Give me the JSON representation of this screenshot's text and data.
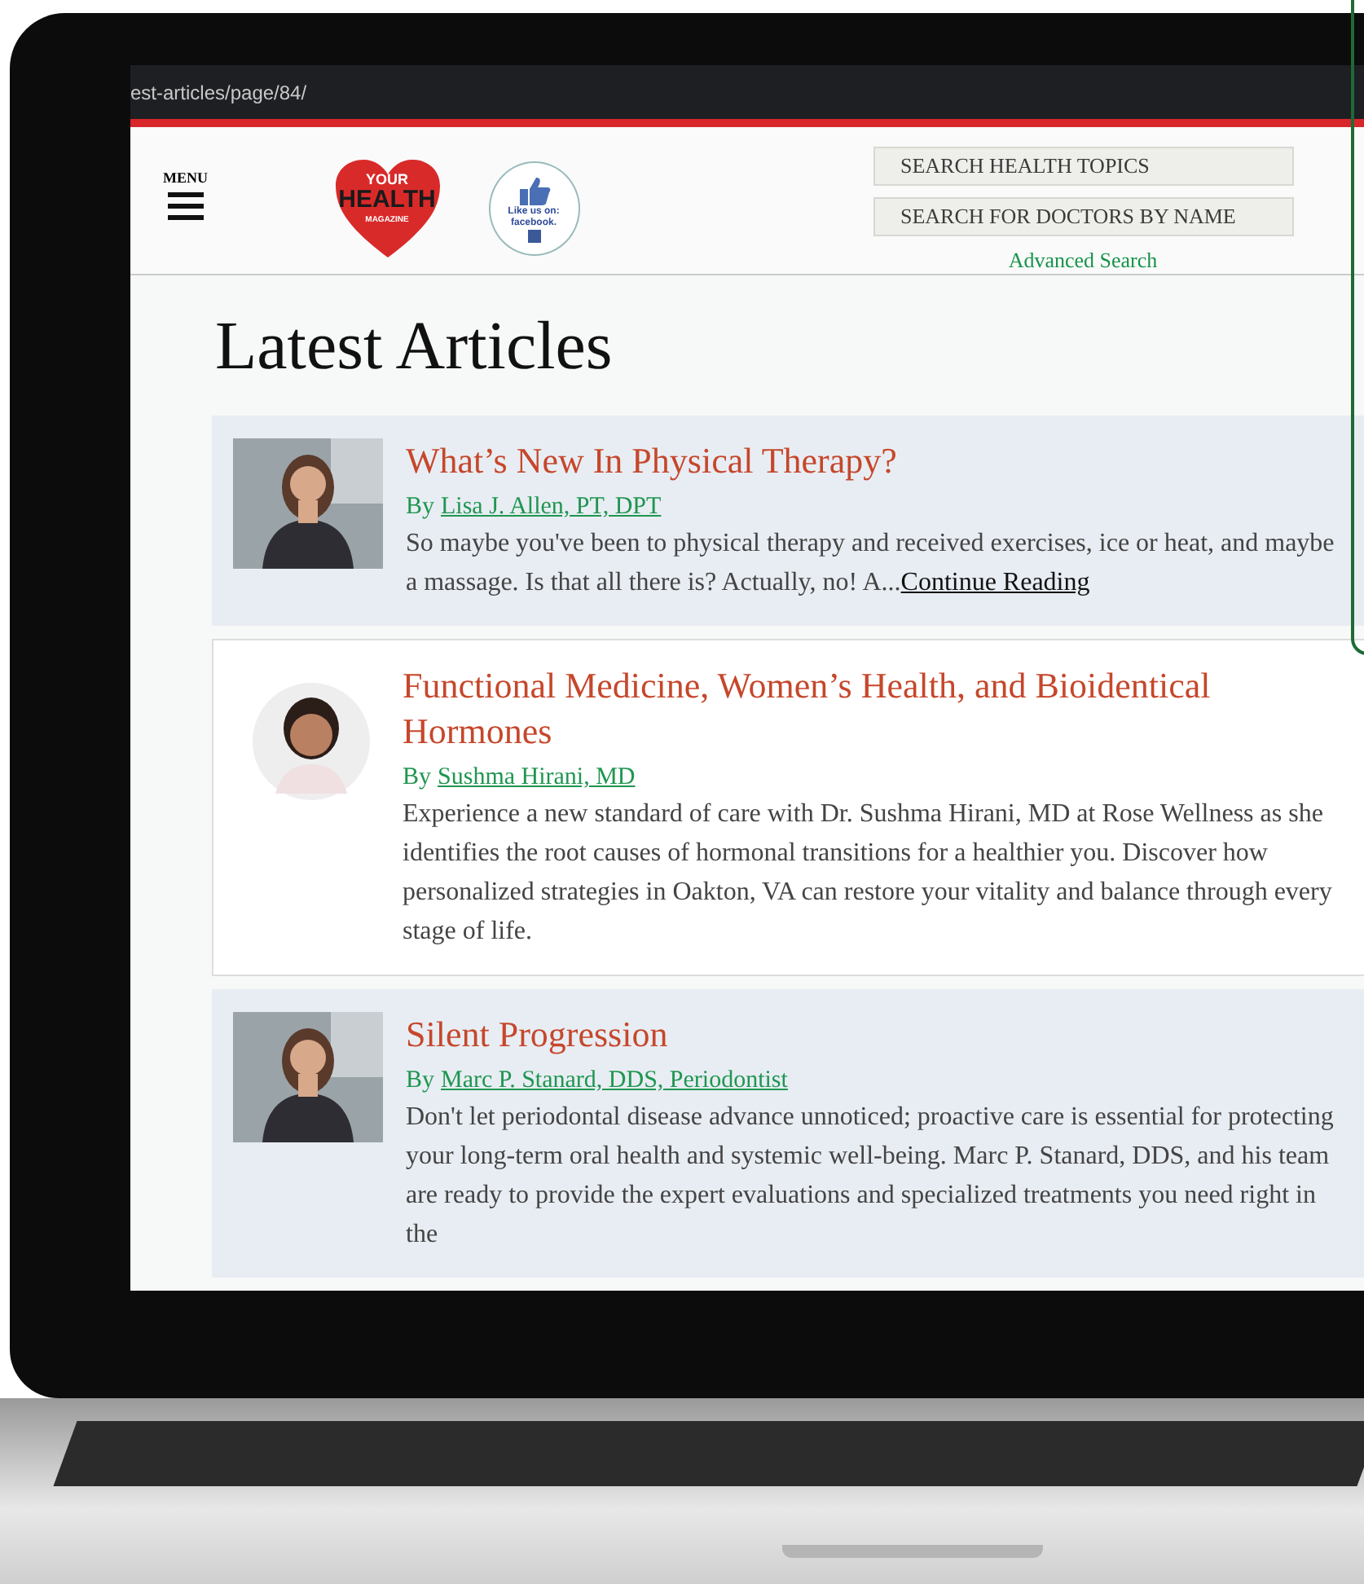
{
  "address_bar": {
    "url": "est-articles/page/84/"
  },
  "header": {
    "menu_label": "MENU",
    "logo": {
      "line_1": "YOUR",
      "line_2": "HEALTH",
      "line_3": "MAGAZINE"
    },
    "facebook_badge": {
      "line_1": "Like us on:",
      "line_2": "facebook."
    },
    "search_fields": [
      {
        "placeholder": "SEARCH HEALTH TOPICS"
      },
      {
        "placeholder": "SEARCH FOR DOCTORS BY NAME"
      }
    ],
    "advanced_search": "Advanced Search"
  },
  "heading": "Latest Articles",
  "articles": [
    {
      "shaded": true,
      "kind": "square",
      "title": "What’s New In Physical Therapy?",
      "by": "By",
      "author": "Lisa J. Allen, PT, DPT",
      "excerpt": "So maybe you've been to physical therapy and received exercises, ice or heat, and maybe a massage. Is that all there is? Actually, no! A...",
      "more": "Continue Reading"
    },
    {
      "shaded": false,
      "kind": "round",
      "title": "Functional Medicine, Women’s Health, and Bioidentical Hormones",
      "by": "By",
      "author": "Sushma Hirani, MD",
      "excerpt": "Experience a new standard of care with Dr. Sushma Hirani, MD at Rose Wellness as she identifies the root causes of hormonal transitions for a healthier you. Discover how personalized strategies in Oakton, VA can restore your vitality and balance through every stage of life."
    },
    {
      "shaded": true,
      "kind": "square",
      "title": "Silent Progression",
      "by": "By",
      "author": "Marc P. Stanard, DDS, Periodontist",
      "excerpt": "Don't let periodontal disease advance unnoticed; proactive care is essential for protecting your long-term oral health and systemic well-being. Marc P. Stanard, DDS, and his team are ready to provide the expert evaluations and specialized treatments you need right in the"
    }
  ]
}
